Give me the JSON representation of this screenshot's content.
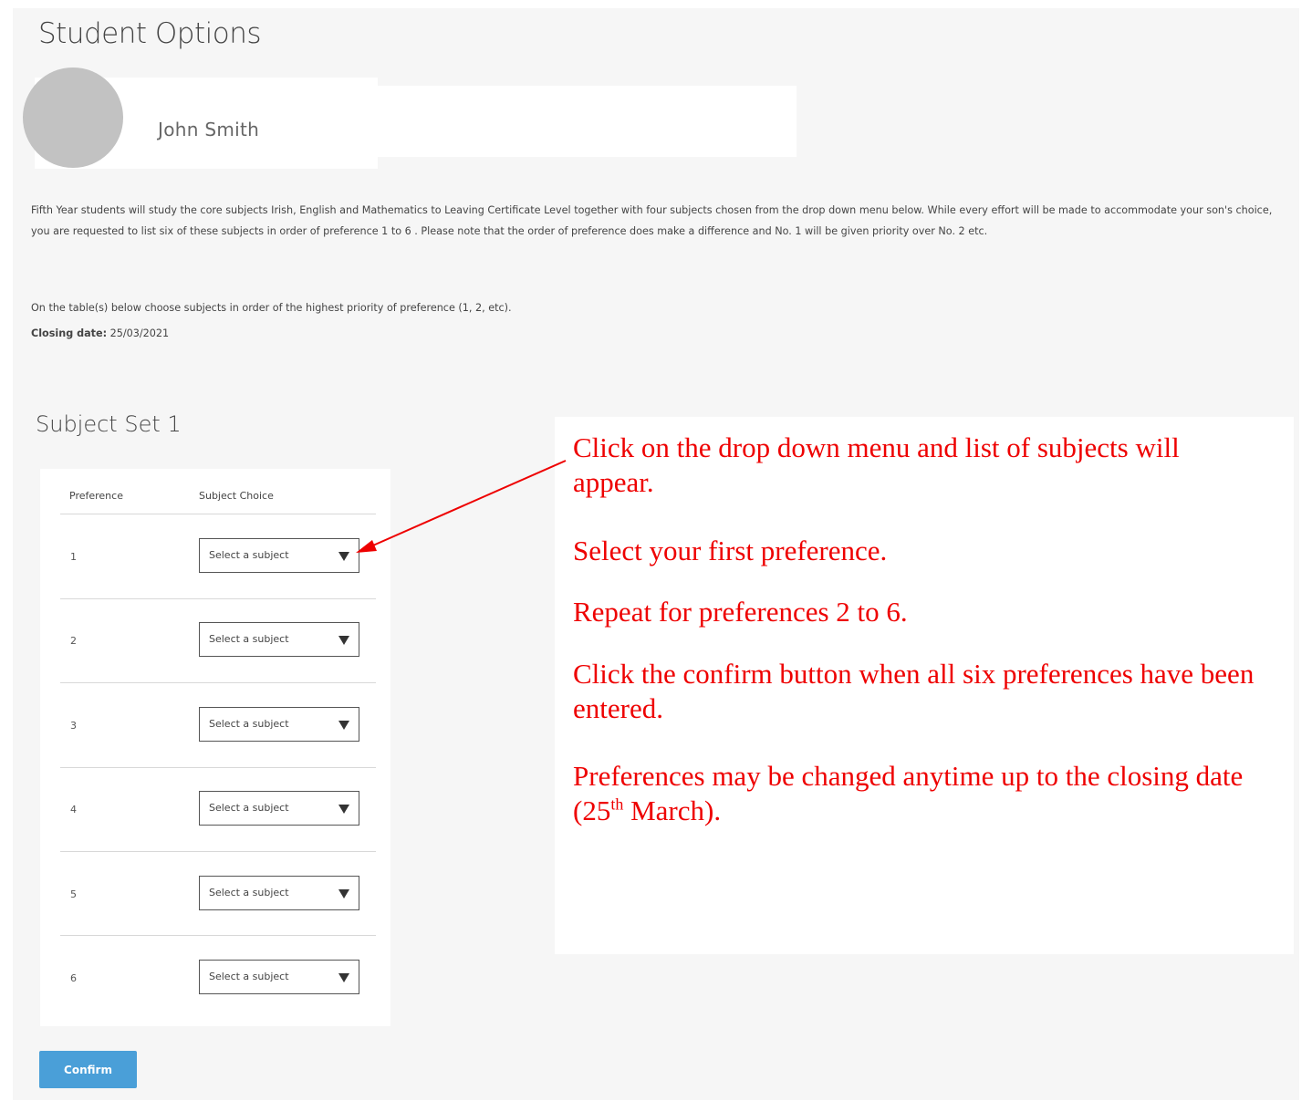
{
  "page": {
    "title": "Student Options"
  },
  "profile": {
    "name": "John Smith"
  },
  "intro": {
    "paragraph": "Fifth Year students will study the core subjects Irish, English and Mathematics to Leaving Certificate Level together with four subjects chosen from the drop down menu below. While every effort will be made to accommodate your son's choice, you are requested to list six of these subjects in order of preference 1 to 6 . Please note that the order of preference does make a difference and No. 1 will be given priority over No. 2 etc.",
    "instruction": "On the table(s) below choose subjects in order of the highest priority of preference (1, 2, etc).",
    "closing_label": "Closing date:",
    "closing_value": "25/03/2021"
  },
  "subject_set": {
    "title": "Subject Set 1",
    "headers": {
      "preference": "Preference",
      "choice": "Subject Choice"
    },
    "rows": [
      {
        "number": "1",
        "selected": "Select a subject"
      },
      {
        "number": "2",
        "selected": "Select a subject"
      },
      {
        "number": "3",
        "selected": "Select a subject"
      },
      {
        "number": "4",
        "selected": "Select a subject"
      },
      {
        "number": "5",
        "selected": "Select a subject"
      },
      {
        "number": "6",
        "selected": "Select a subject"
      }
    ]
  },
  "buttons": {
    "confirm": "Confirm"
  },
  "callout": {
    "line1": "Click on the drop down menu and list of subjects will appear.",
    "line2": "Select your first preference.",
    "line3": "Repeat for preferences 2 to 6.",
    "line4": "Click the confirm button when all six preferences have been entered.",
    "line5_before": "Preferences may be changed anytime up to the closing date (25",
    "line5_sup": "th",
    "line5_after": " March)."
  },
  "colors": {
    "background": "#f6f6f6",
    "card": "#ffffff",
    "accent": "#4a9fd8",
    "annotation": "#ee0000",
    "avatar": "#c2c2c2"
  }
}
